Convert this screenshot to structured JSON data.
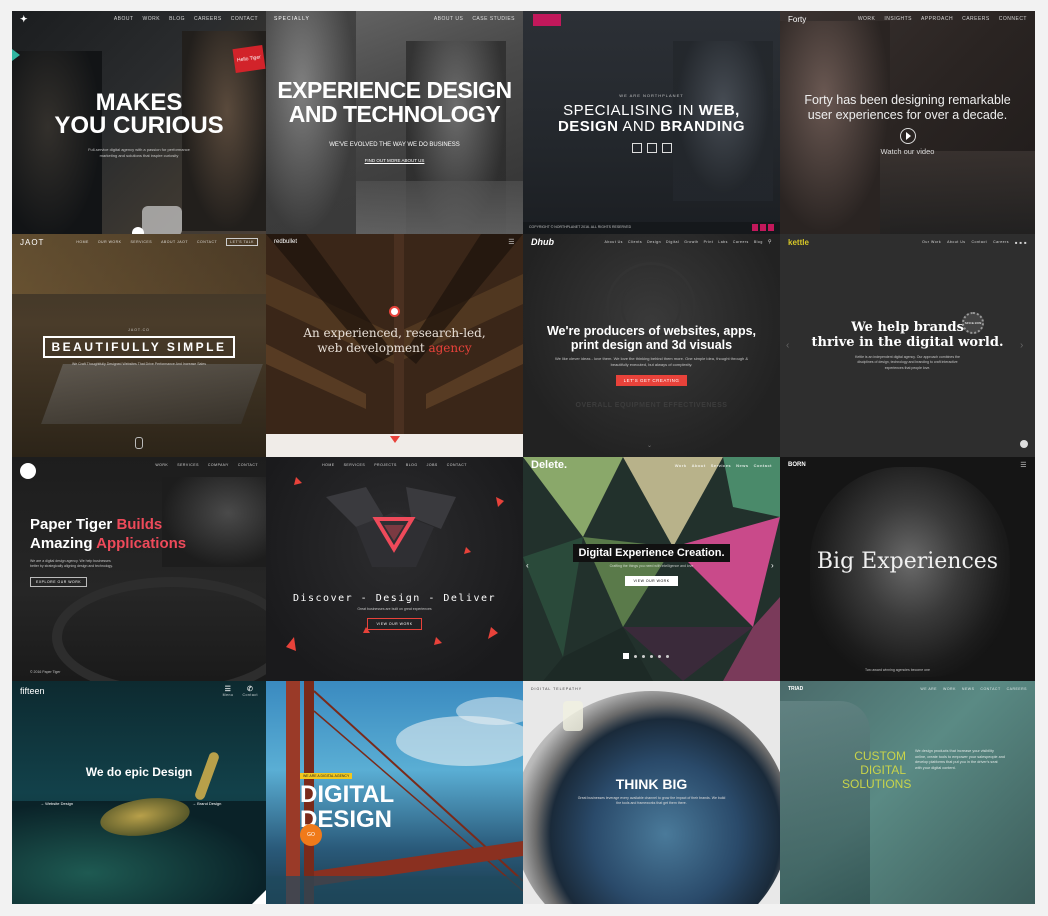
{
  "tiles": [
    {
      "id": "t1",
      "headline_1": "MAKES",
      "headline_2": "YOU CURIOUS",
      "sub": "Full-service digital agency with a passion for performance marketing and solutions that inspire curiosity",
      "badge": "Hello Tiger",
      "nav": [
        "ABOUT",
        "WORK",
        "BLOG",
        "CAREERS",
        "CONTACT"
      ]
    },
    {
      "id": "t2",
      "logo": "SPECIALLY",
      "nav": [
        "ABOUT US",
        "CASE STUDIES"
      ],
      "headline_1": "EXPERIENCE DESIGN",
      "headline_2": "AND TECHNOLOGY",
      "sub": "WE'VE EVOLVED THE WAY WE DO BUSINESS",
      "link": "FIND OUT MORE ABOUT US"
    },
    {
      "id": "t3",
      "kicker": "WE ARE NORTHPLANET",
      "line_1a": "SPECIALISING IN ",
      "line_1b": "WEB,",
      "line_2a": "DESIGN",
      "line_2b": " AND ",
      "line_2c": "BRANDING",
      "footer": "COPYRIGHT © NORTHPLANET 2016. ALL RIGHTS RESERVED"
    },
    {
      "id": "t4",
      "logo": "Forty",
      "nav": [
        "WORK",
        "INSIGHTS",
        "APPROACH",
        "CAREERS",
        "CONNECT"
      ],
      "line_1": "Forty has been designing remarkable",
      "line_2": "user experiences for over a decade.",
      "cta": "Watch our video"
    },
    {
      "id": "t5",
      "logo": "JAOT",
      "nav": [
        "HOME",
        "OUR WORK",
        "SERVICES",
        "ABOUT JAOT",
        "CONTACT",
        "LET'S TALK"
      ],
      "kicker": "JAOT.CO",
      "headline": "BEAUTIFULLY SIMPLE",
      "sub": "We Craft Thoughtfully Designed Websites That Drive Performance And Increase Sales"
    },
    {
      "id": "t6",
      "logo": "redbullet",
      "line_1": "An experienced, research-led,",
      "line_2a": "web development ",
      "line_2b": "agency"
    },
    {
      "id": "t7",
      "logo": "Dhub",
      "nav": [
        "About Us",
        "Clients",
        "Design",
        "Digital",
        "Growth",
        "Print",
        "Labs",
        "Careers",
        "Blog"
      ],
      "line_1": "We're producers of websites, apps,",
      "line_2": "print design and 3d visuals",
      "sub": "We like clever ideas - love them. We love the thinking behind them more. One simple idea, thought through & beautifully executed, but always of complexity.",
      "cta": "LET'S GET CREATING",
      "bg_text": "OVERALL EQUIPMENT EFFECTIVENESS"
    },
    {
      "id": "t8",
      "logo": "kettle",
      "nav": [
        "Our Work",
        "About Us",
        "Contact",
        "Careers"
      ],
      "line_1": "We help brands",
      "line_2": "thrive in the digital world.",
      "badge": "SINCE 2009",
      "sub": "Kettle is an independent digital agency. Our approach combines the disciplines of design, technology and branding to craft interactive experiences that people love."
    },
    {
      "id": "t9",
      "logo": "paper tiger",
      "nav": [
        "WORK",
        "SERVICES",
        "COMPANY",
        "CONTACT"
      ],
      "line_1a": "Paper Tiger ",
      "line_1b": "Builds",
      "line_2a": "Amazing ",
      "line_2b": "Applications",
      "sub": "We are a digital design agency. We help businesses better by strategically aligning design and technology.",
      "cta": "EXPLORE OUR WORK",
      "footer": "© 2016 Paper Tiger"
    },
    {
      "id": "t10",
      "nav": [
        "HOME",
        "SERVICES",
        "PROJECTS",
        "BLOG",
        "JOBS",
        "CONTACT"
      ],
      "headline": "Discover - Design - Deliver",
      "sub": "Great businesses are built on great experiences",
      "cta": "VIEW OUR WORK"
    },
    {
      "id": "t11",
      "logo": "Delete.",
      "nav": [
        "Work",
        "About",
        "Services",
        "News",
        "Contact"
      ],
      "headline": "Digital Experience Creation.",
      "sub": "Crafting the things you need with intelligence and love",
      "cta": "VIEW OUR WORK"
    },
    {
      "id": "t12",
      "logo": "BORN",
      "headline": "Big Experiences",
      "footer": "Two award winning agencies become one"
    },
    {
      "id": "t13",
      "logo": "fifteen",
      "menu": "Menu",
      "contact": "Contact",
      "headline": "We do epic Design",
      "link_1": "Website Design",
      "link_2": "Brand Design"
    },
    {
      "id": "t14",
      "kicker": "WE ARE A DIGITAL AGENCY",
      "headline_1": "DIGITAL",
      "headline_2": "DESIGN",
      "cta": "GO"
    },
    {
      "id": "t15",
      "logo": "DIGITAL TELEPATHY",
      "headline": "THINK BIG",
      "sub": "Great businesses leverage every available channel to grow the impact of their brands. We build the tools and frameworks that get them there."
    },
    {
      "id": "t16",
      "logo": "TRIAD",
      "nav": [
        "WE ARE",
        "WORK",
        "NEWS",
        "CONTACT",
        "CAREERS"
      ],
      "line_1": "CUSTOM",
      "line_2": "DIGITAL",
      "line_3": "SOLUTIONS",
      "sub": "We design products that increase your visibility online, create tools to empower your salespeople and develop platforms that put you in the driver's seat with your digital content."
    }
  ],
  "colors": {
    "red": "#e8423a",
    "pink": "#ee4a5a",
    "lime": "#c9d44a",
    "yellow": "#f2c81e",
    "orange": "#f07a1a"
  }
}
